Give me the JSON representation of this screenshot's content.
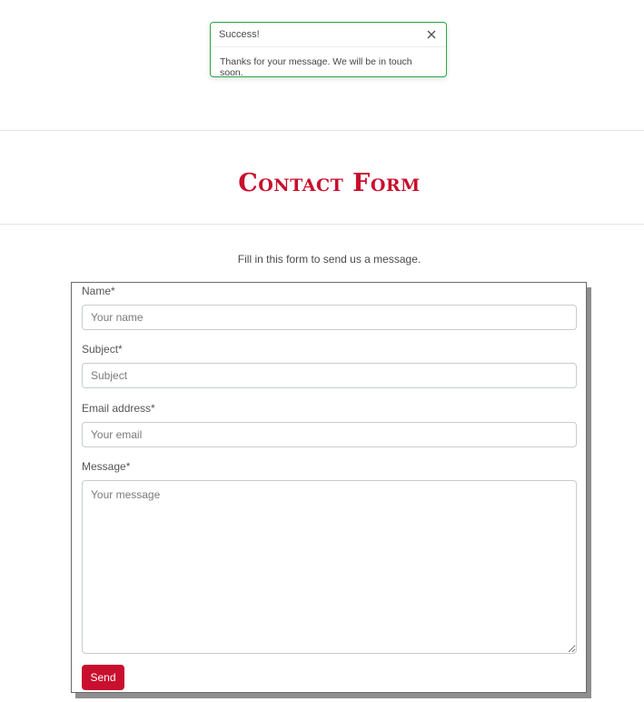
{
  "toast": {
    "title": "Success!",
    "message": "Thanks for your message. We will be in touch soon.",
    "close_icon": "close-icon",
    "accent": "#28a745"
  },
  "header": {
    "title": "Contact Form"
  },
  "intro": "Fill in this form to send us a message.",
  "form": {
    "name_label": "Name*",
    "name_placeholder": "Your name",
    "subject_label": "Subject*",
    "subject_placeholder": "Subject",
    "email_label": "Email address*",
    "email_placeholder": "Your email",
    "message_label": "Message*",
    "message_placeholder": "Your message",
    "send_label": "Send"
  },
  "colors": {
    "brand": "#c8102e",
    "success": "#28a745"
  }
}
